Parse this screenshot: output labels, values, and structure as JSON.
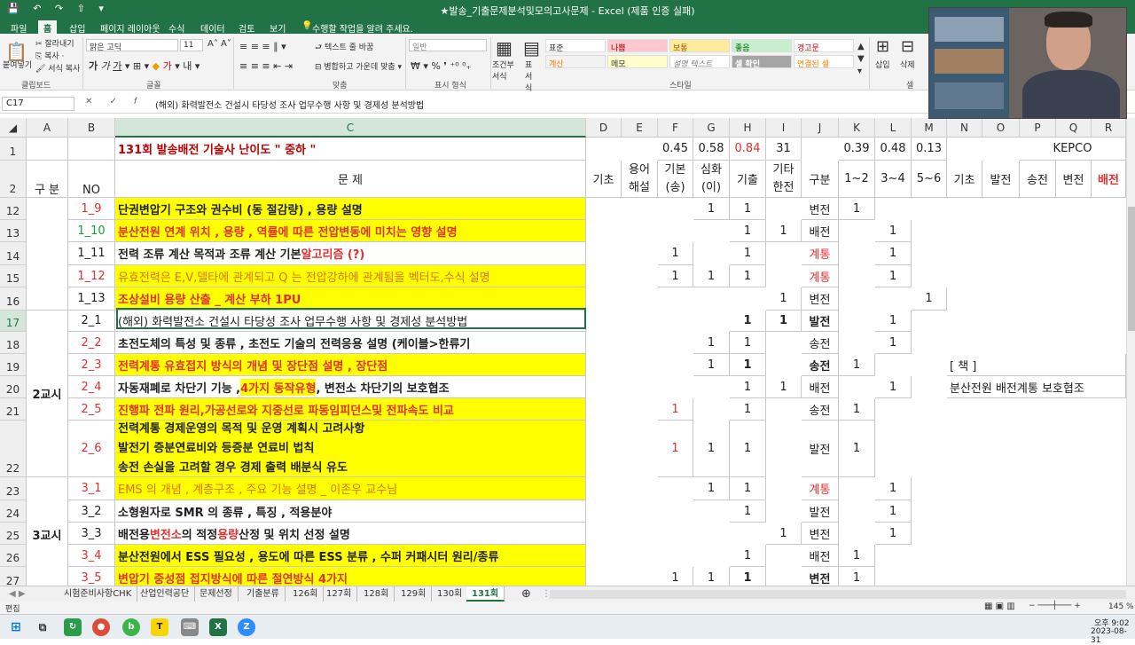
{
  "titlebar": {
    "quick_access": "💾 ↶ ↷ ⇧ ▾",
    "title": "★발송_기출문제분석및모의고사문제 - Excel (제품 인증 실패)"
  },
  "menu": [
    "파일",
    "홈",
    "삽입",
    "페이지 레이아웃",
    "수식",
    "데이터",
    "검토",
    "보기"
  ],
  "menu_help": "수행할 작업을 알려 주세요.",
  "ribbon": {
    "paste": "붙여넣기",
    "cut": "잘라내기",
    "copy": "복사 ·",
    "format_painter": "서식 복사",
    "clipboard": "클립보드",
    "font_name": "맑은 고딕",
    "font_size": "11",
    "font_group": "글꼴",
    "wrap": "텍스트 줄 바꿈",
    "merge": "병합하고 가운데 맞춤",
    "align_group": "맞춤",
    "number_format": "일반",
    "number_group": "표시 형식",
    "cond": "조건부 서식",
    "table": "표 서식",
    "style_group": "스타일",
    "insert": "삽입",
    "delete": "삭제",
    "cells_group": "셀",
    "styles": [
      "표준",
      "나쁨",
      "보통",
      "좋음",
      "경고문",
      "계산",
      "메모",
      "설명 텍스트",
      "셀 확인",
      "연결된 셀"
    ]
  },
  "namebox": "C17",
  "formula": "(해외) 화력발전소 건설시 타당성 조사 업무수행 사항 및 경제성 분석방법",
  "columns": [
    "A",
    "B",
    "C",
    "D",
    "E",
    "F",
    "G",
    "H",
    "I",
    "J",
    "K",
    "L",
    "M",
    "N",
    "O",
    "P",
    "Q",
    "R"
  ],
  "rows": {
    "r1": {
      "num": "1",
      "title": "131회 발송배전 기술사  난이도     \" 중하 \"",
      "F": "0.45",
      "G": "0.58",
      "H": "0.84",
      "I": "31",
      "K": "0.39",
      "L": "0.48",
      "M": "0.13",
      "kepco": "KEPCO"
    },
    "r2": {
      "num": "2",
      "A": "구 분",
      "B": "NO",
      "C": "문 제",
      "D": "기초",
      "E1": "용어",
      "E2": "해설",
      "F1": "기본",
      "F2": "(송)",
      "G1": "심화",
      "G2": "(이)",
      "H": "기출",
      "I1": "기타",
      "I2": "한전",
      "J": "구분",
      "K": "1~2",
      "L": "3~4",
      "M": "5~6",
      "N": "기초",
      "O": "발전",
      "P": "송전",
      "Q": "변전",
      "R": "배전"
    },
    "r12": {
      "num": "12",
      "B": "1_9",
      "C": "단권변압기 구조와 권수비 (동 절감량) , 용량 설명",
      "G": "1",
      "H": "1",
      "J": "변전",
      "K": "1"
    },
    "r13": {
      "num": "13",
      "B": "1_10",
      "C": "분산전원 연계 위치 , 용량 , 역률에 따른 전압변동에 미치는 영향 설명",
      "H": "1",
      "I": "1",
      "J": "배전",
      "L": "1"
    },
    "r14": {
      "num": "14",
      "B": "1_11",
      "C1": "전력 조류 계산 목적과 조류 계산 기본 ",
      "C2": "알고리즘 (?)",
      "F": "1",
      "H": "1",
      "J": "계통",
      "L": "1"
    },
    "r15": {
      "num": "15",
      "B": "1_12",
      "C": "유효전력은 E,V,델타에 관계되고 Q 는 전압강하에 관계됨을 벡터도,수식 설명",
      "F": "1",
      "G": "1",
      "H": "1",
      "J": "계통",
      "L": "1"
    },
    "r16": {
      "num": "16",
      "B": "1_13",
      "C": "조상설비 용량 산출  _ 계산       부하 1PU",
      "I": "1",
      "J": "변전",
      "M": "1"
    },
    "r17": {
      "num": "17",
      "B": "2_1",
      "C": "(해외) 화력발전소 건설시 타당성 조사 업무수행 사항 및 경제성 분석방법",
      "H": "1",
      "I": "1",
      "J": "발전",
      "L": "1"
    },
    "r18": {
      "num": "18",
      "B": "2_2",
      "C": "초전도체의 특성 및 종류 , 초전도 기술의 전력응용 설명 (케이블>한류기",
      "G": "1",
      "H": "1",
      "J": "송전",
      "L": "1"
    },
    "r19": {
      "num": "19",
      "B": "2_3",
      "C": "전력계통 유효접지 방식의 개념 및 장단점 설명  , 장단점",
      "G": "1",
      "H": "1",
      "J": "송전",
      "K": "1",
      "N": "[ 책 ]"
    },
    "r20": {
      "num": "20",
      "A": "2교시",
      "B": "2_4",
      "C1": "자동재폐로 차단기 기능 , ",
      "C2": "4가지 동작유형",
      "C3": " , 변전소 차단기의 보호협조",
      "H": "1",
      "I": "1",
      "J": "배전",
      "L": "1",
      "N": "분산전원 배전계통 보호협조"
    },
    "r21": {
      "num": "21",
      "B": "2_5",
      "C": "진행파 전파 원리,가공선로와 지중선로 파동임피던스및 전파속도 비교",
      "F": "1",
      "H": "1",
      "J": "송전",
      "K": "1"
    },
    "r22": {
      "num": "22",
      "B": "2_6",
      "C1": "전력계통 경제운영의 목적 및 운영 계획시 고려사항",
      "C2": "발전기 증분연료비와 등증분 연료비 법칙",
      "C3": "송전 손실을 고려할 경우 경제 출력 배분식 유도",
      "F": "1",
      "G": "1",
      "H": "1",
      "J": "발전",
      "K": "1"
    },
    "r23": {
      "num": "23",
      "B": "3_1",
      "C": "EMS 의 개념 , 계층구조 , 주요 기능 설명 _ 이존우 교수님",
      "G": "1",
      "H": "1",
      "J": "계통",
      "L": "1"
    },
    "r24": {
      "num": "24",
      "B": "3_2",
      "C": "소형원자로  SMR 의 종류 , 특징 , 적용분야",
      "H": "1",
      "J": "발전",
      "L": "1"
    },
    "r25": {
      "num": "25",
      "B": "3_3",
      "C1": "배전용 ",
      "C2": "변전소",
      "C3": "의 적정 ",
      "C4": "용량",
      "C5": " 산정 및 위치 선정 설명",
      "I": "1",
      "J": "변전",
      "L": "1"
    },
    "r26": {
      "num": "26",
      "A": "3교시",
      "B": "3_4",
      "C": "분산전원에서 ESS 필요성 , 용도에 따른 ESS 분류 , 수퍼 커패시터 원리/종류",
      "H": "1",
      "J": "배전",
      "K": "1"
    },
    "r27": {
      "num": "27",
      "B": "3_5",
      "C": "변압기 중성점 접지방식에 따른 절연방식 4가지",
      "F": "1",
      "G": "1",
      "H": "1",
      "J": "변전",
      "K": "1"
    }
  },
  "sheets": [
    "시험준비사항CHK",
    "산업인력공단",
    "문제선정",
    "기출분류",
    "126회",
    "127회",
    "128회",
    "129회",
    "130회",
    "131회"
  ],
  "status": {
    "mode": "편집",
    "zoom": "145 %"
  },
  "taskbar": {
    "time": "오후 9:02",
    "date": "2023-08-31"
  },
  "colors": {
    "excel_green": "#217346",
    "highlight": "#ffff00",
    "red": "#e03030"
  }
}
